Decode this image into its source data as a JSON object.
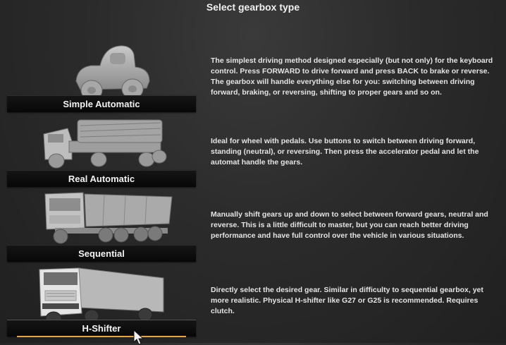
{
  "title": "Select gearbox type",
  "options": [
    {
      "label": "Simple Automatic",
      "description": "The simplest driving method designed especially (but not only) for the keyboard control. Press FORWARD to drive forward and press BACK to brake or reverse. The gearbox will handle everything else for you: switching between driving forward, braking, or reversing, shifting to proper gears and so on.",
      "icon": "toy-truck-icon"
    },
    {
      "label": "Real Automatic",
      "description": "Ideal for wheel with pedals. Use buttons to switch between driving forward, standing (neutral), or reversing. Then press the accelerator pedal and let the automat handle the gears.",
      "icon": "wooden-log-truck-icon"
    },
    {
      "label": "Sequential",
      "description": "Manually shift gears up and down to select between forward gears, neutral and reverse. This is a little difficult to master, but you can reach better driving performance and have full control over the vehicle in various situations.",
      "icon": "dump-truck-icon"
    },
    {
      "label": "H-Shifter",
      "description": "Directly select the desired gear. Similar in difficulty to sequential gearbox, yet more realistic. Physical H-shifter like G27 or G25 is recommended. Requires clutch.",
      "icon": "semi-truck-icon",
      "selected": true
    }
  ],
  "colors": {
    "accent": "#e8a634",
    "background": "#2b2b2b",
    "bar": "#0a0a0a"
  }
}
